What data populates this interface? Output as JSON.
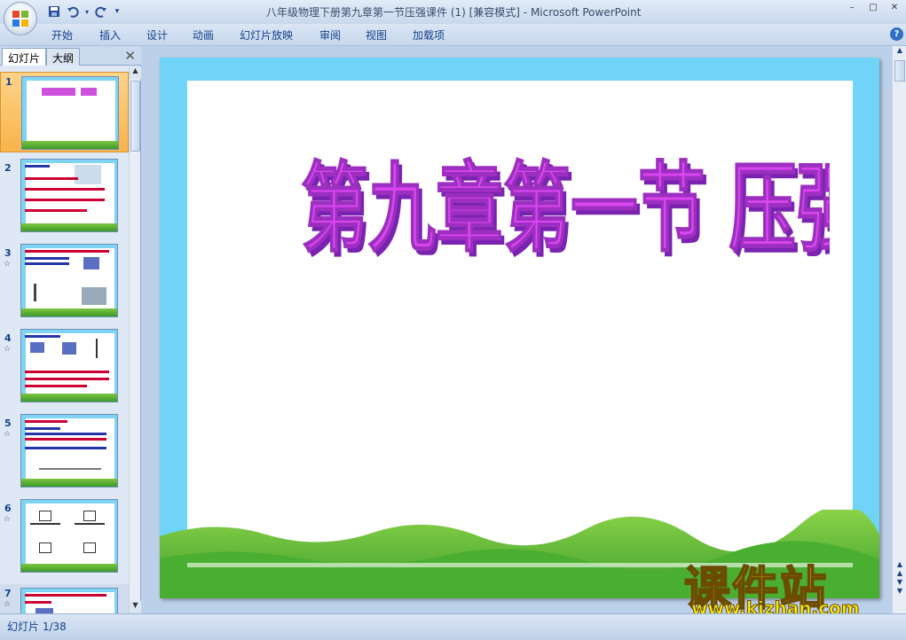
{
  "window": {
    "title": "八年级物理下册第九章第一节压强课件 (1) [兼容模式] - Microsoft PowerPoint",
    "controls": [
      "–",
      "□",
      "✕"
    ]
  },
  "quick_access": {
    "save_icon": "save-icon",
    "undo_icon": "undo-icon",
    "redo_icon": "redo-icon",
    "customize_icon": "customize-icon"
  },
  "ribbon": {
    "tabs": [
      "开始",
      "插入",
      "设计",
      "动画",
      "幻灯片放映",
      "审阅",
      "视图",
      "加载项"
    ],
    "help_label": "?"
  },
  "panel": {
    "tab_slides": "幻灯片",
    "tab_outline": "大纲",
    "close_label": "✕",
    "slide_numbers": [
      "1",
      "2",
      "3",
      "4",
      "5",
      "6",
      "7"
    ],
    "anim_marker": "☆"
  },
  "slide": {
    "title": "第九章第一节 压强",
    "title_color": "#c026d3",
    "bg_color": "#6fd4f7"
  },
  "watermark": {
    "text": "课件站",
    "url": "www.kjzhan.com",
    "color": "#f5ea14"
  },
  "status": {
    "slide_counter": "幻灯片 1/38"
  }
}
